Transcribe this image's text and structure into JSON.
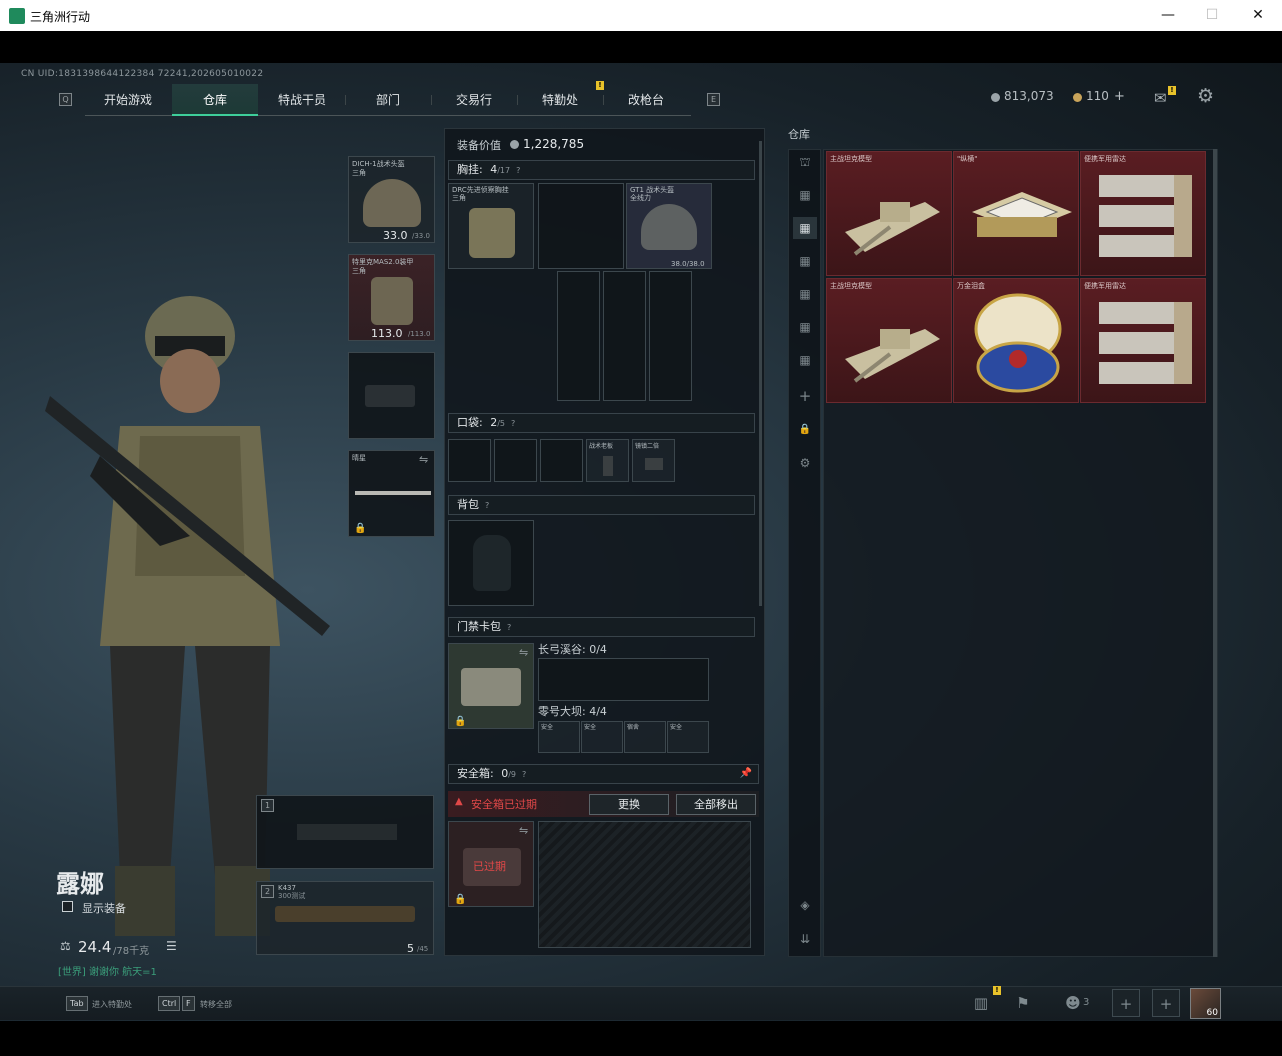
{
  "window": {
    "title": "三角洲行动"
  },
  "uid": "CN UID:1831398644122384 72241,202605010022",
  "nav": {
    "left_key": "Q",
    "right_key": "E",
    "tabs": [
      "开始游戏",
      "仓库",
      "特战干员",
      "部门",
      "交易行",
      "特勤处",
      "改枪台"
    ],
    "active": "仓库",
    "badge": "!"
  },
  "currency": {
    "coins": "813,073",
    "tickets": "110",
    "plus": "+",
    "mail_badge": "!"
  },
  "equipment": {
    "value_label": "装备价值",
    "value": "1,228,785",
    "helmet": {
      "name": "DICH-1战术头盔",
      "sub": "三角",
      "durability": "33.0",
      "max": "/33.0"
    },
    "armor": {
      "name": "特里克MAS2.0装甲",
      "sub": "三角",
      "durability": "113.0",
      "max": "/113.0"
    },
    "melee": {
      "name": "晴星"
    },
    "weapon1": {
      "slot": "1"
    },
    "weapon2": {
      "slot": "2",
      "name": "K437",
      "sub": "300测试",
      "ammo": "5",
      "ammo_max": "/45"
    }
  },
  "character": {
    "name": "露娜",
    "show_gear_label": "显示装备",
    "weight": "24.4",
    "weight_max": "/78千克",
    "note": "[世界] 谢谢你 航天=1"
  },
  "chest": {
    "label": "胸挂:",
    "count": "4",
    "cap": "/17",
    "q": "?",
    "rig": {
      "name": "DRC先进侦察胸挂",
      "sub": "三角"
    },
    "helmet2": {
      "name": "GT1 战术头盔",
      "sub": "全线力",
      "durability": "38.0/38.0"
    }
  },
  "pocket": {
    "label": "口袋:",
    "count": "2",
    "cap": "/5",
    "q": "?",
    "item1": "战术老板",
    "item2": "镜镇二倍"
  },
  "backpack": {
    "label": "背包",
    "q": "?"
  },
  "keycard": {
    "label": "门禁卡包",
    "q": "?",
    "vault1": "长弓溪谷: 0/4",
    "vault2": "零号大坝: 4/4",
    "cards": [
      "安全",
      "安全",
      "宿舍",
      "安全"
    ]
  },
  "secure": {
    "label": "安全箱:",
    "count": "0",
    "cap": "/9",
    "q": "?",
    "expired": "安全箱已过期",
    "btn_replace": "更换",
    "btn_remove": "全部移出",
    "expired_tag": "已过期"
  },
  "warehouse": {
    "title": "仓库",
    "items": [
      {
        "label": "主战坦克模型"
      },
      {
        "label": "\"纵横\""
      },
      {
        "label": "便携军用雷达"
      },
      {
        "label": "主战坦克模型"
      },
      {
        "label": "万金泪盒"
      },
      {
        "label": "便携军用雷达"
      }
    ]
  },
  "bottom": {
    "tab_key": "Tab",
    "tab_label": "进入特勤处",
    "ctrl": "Ctrl",
    "f": "F",
    "transfer_label": "转移全部",
    "friends": "3",
    "level": "60",
    "badge": "!"
  }
}
